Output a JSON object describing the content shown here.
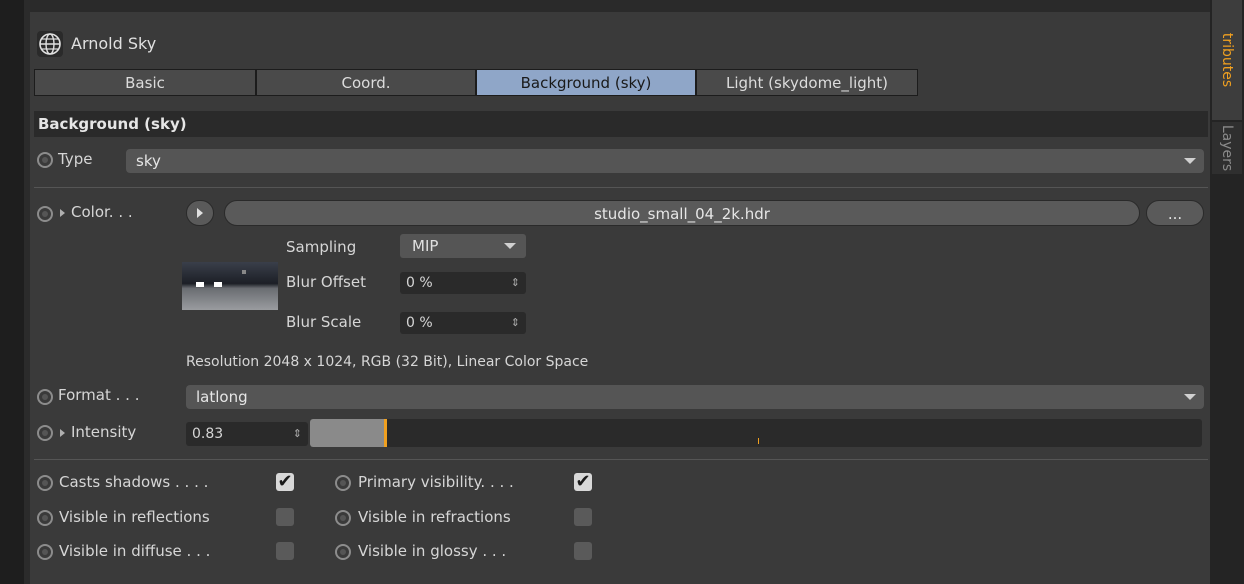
{
  "title": "Arnold Sky",
  "tabs": [
    "Basic",
    "Coord.",
    "Background (sky)",
    "Light (skydome_light)"
  ],
  "section_title": "Background (sky)",
  "type": {
    "label": "Type",
    "value": "sky"
  },
  "color": {
    "label": "Color. . .",
    "filename": "studio_small_04_2k.hdr",
    "browse_label": "..."
  },
  "sampling": {
    "label": "Sampling",
    "value": "MIP"
  },
  "blur_offset": {
    "label": "Blur Offset",
    "value": "0 %"
  },
  "blur_scale": {
    "label": "Blur Scale",
    "value": "0 %"
  },
  "resolution": "Resolution 2048 x 1024, RGB (32 Bit), Linear Color Space",
  "format": {
    "label": "Format . . .",
    "value": "latlong"
  },
  "intensity": {
    "label": "Intensity",
    "value": "0.83",
    "fraction": 0.083
  },
  "checkboxes": [
    {
      "label": "Casts shadows . . . .",
      "checked": true
    },
    {
      "label": "Primary visibility. . . .",
      "checked": true
    },
    {
      "label": "Visible in reflections",
      "checked": false
    },
    {
      "label": "Visible in refractions",
      "checked": false
    },
    {
      "label": "Visible in diffuse . . .",
      "checked": false
    },
    {
      "label": "Visible in glossy . . .",
      "checked": false
    }
  ],
  "side_tabs": [
    "tributes",
    "Layers"
  ],
  "colors": {
    "accent": "#f0a020",
    "selected_tab": "#8fa6c8",
    "panel": "#3a3a3a"
  },
  "icons": {
    "title": "globe-icon",
    "color": "play-icon"
  }
}
